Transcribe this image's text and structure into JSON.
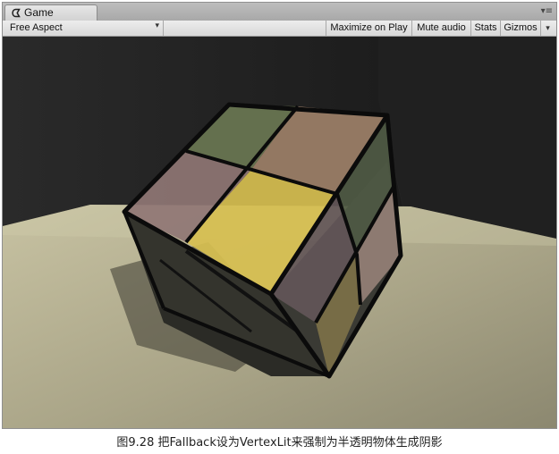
{
  "window": {
    "tab_title": "Game",
    "tab_icon": "pacman-game-icon",
    "menu_icon": "panel-menu-icon"
  },
  "toolbar": {
    "aspect_label": "Free Aspect",
    "maximize_label": "Maximize on Play",
    "mute_label": "Mute audio",
    "stats_label": "Stats",
    "gizmos_label": "Gizmos"
  },
  "scene": {
    "faces": {
      "top": [
        "#6a7752",
        "#9d8068",
        "#8f7674",
        "#d7bf50"
      ],
      "right": [
        "#4f5a44",
        "#635658",
        "#958076",
        "#7d7148"
      ]
    },
    "floor_color": "#b3ae90",
    "backdrop_color": "#262626"
  },
  "caption": "图9.28 把Fallback设为VertexLit来强制为半透明物体生成阴影"
}
